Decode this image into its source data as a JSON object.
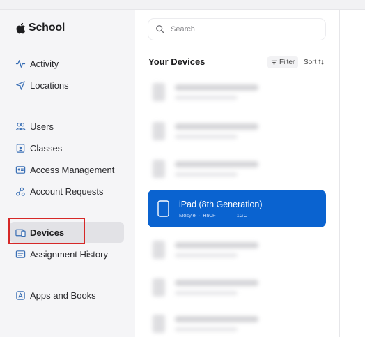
{
  "sidebar": {
    "brand": "School",
    "items": [
      {
        "label": "Activity",
        "icon": "activity-icon"
      },
      {
        "label": "Locations",
        "icon": "location-arrow-icon"
      },
      {
        "label": "Users",
        "icon": "users-icon"
      },
      {
        "label": "Classes",
        "icon": "classes-icon"
      },
      {
        "label": "Access Management",
        "icon": "access-management-icon"
      },
      {
        "label": "Account Requests",
        "icon": "account-requests-icon"
      },
      {
        "label": "Devices",
        "icon": "devices-icon",
        "active": true
      },
      {
        "label": "Assignment History",
        "icon": "assignment-history-icon"
      },
      {
        "label": "Apps and Books",
        "icon": "apps-books-icon"
      }
    ]
  },
  "list": {
    "search_placeholder": "Search",
    "title": "Your Devices",
    "filter_label": "Filter",
    "sort_label": "Sort",
    "selected_device": {
      "name": "iPad (8th Generation)",
      "meta1": "Mosyle",
      "meta2": "H90F",
      "meta3": "1GC"
    }
  },
  "colors": {
    "accent": "#0a63d0",
    "highlight": "#d62828",
    "sidebar_bg": "#f5f5f7"
  }
}
